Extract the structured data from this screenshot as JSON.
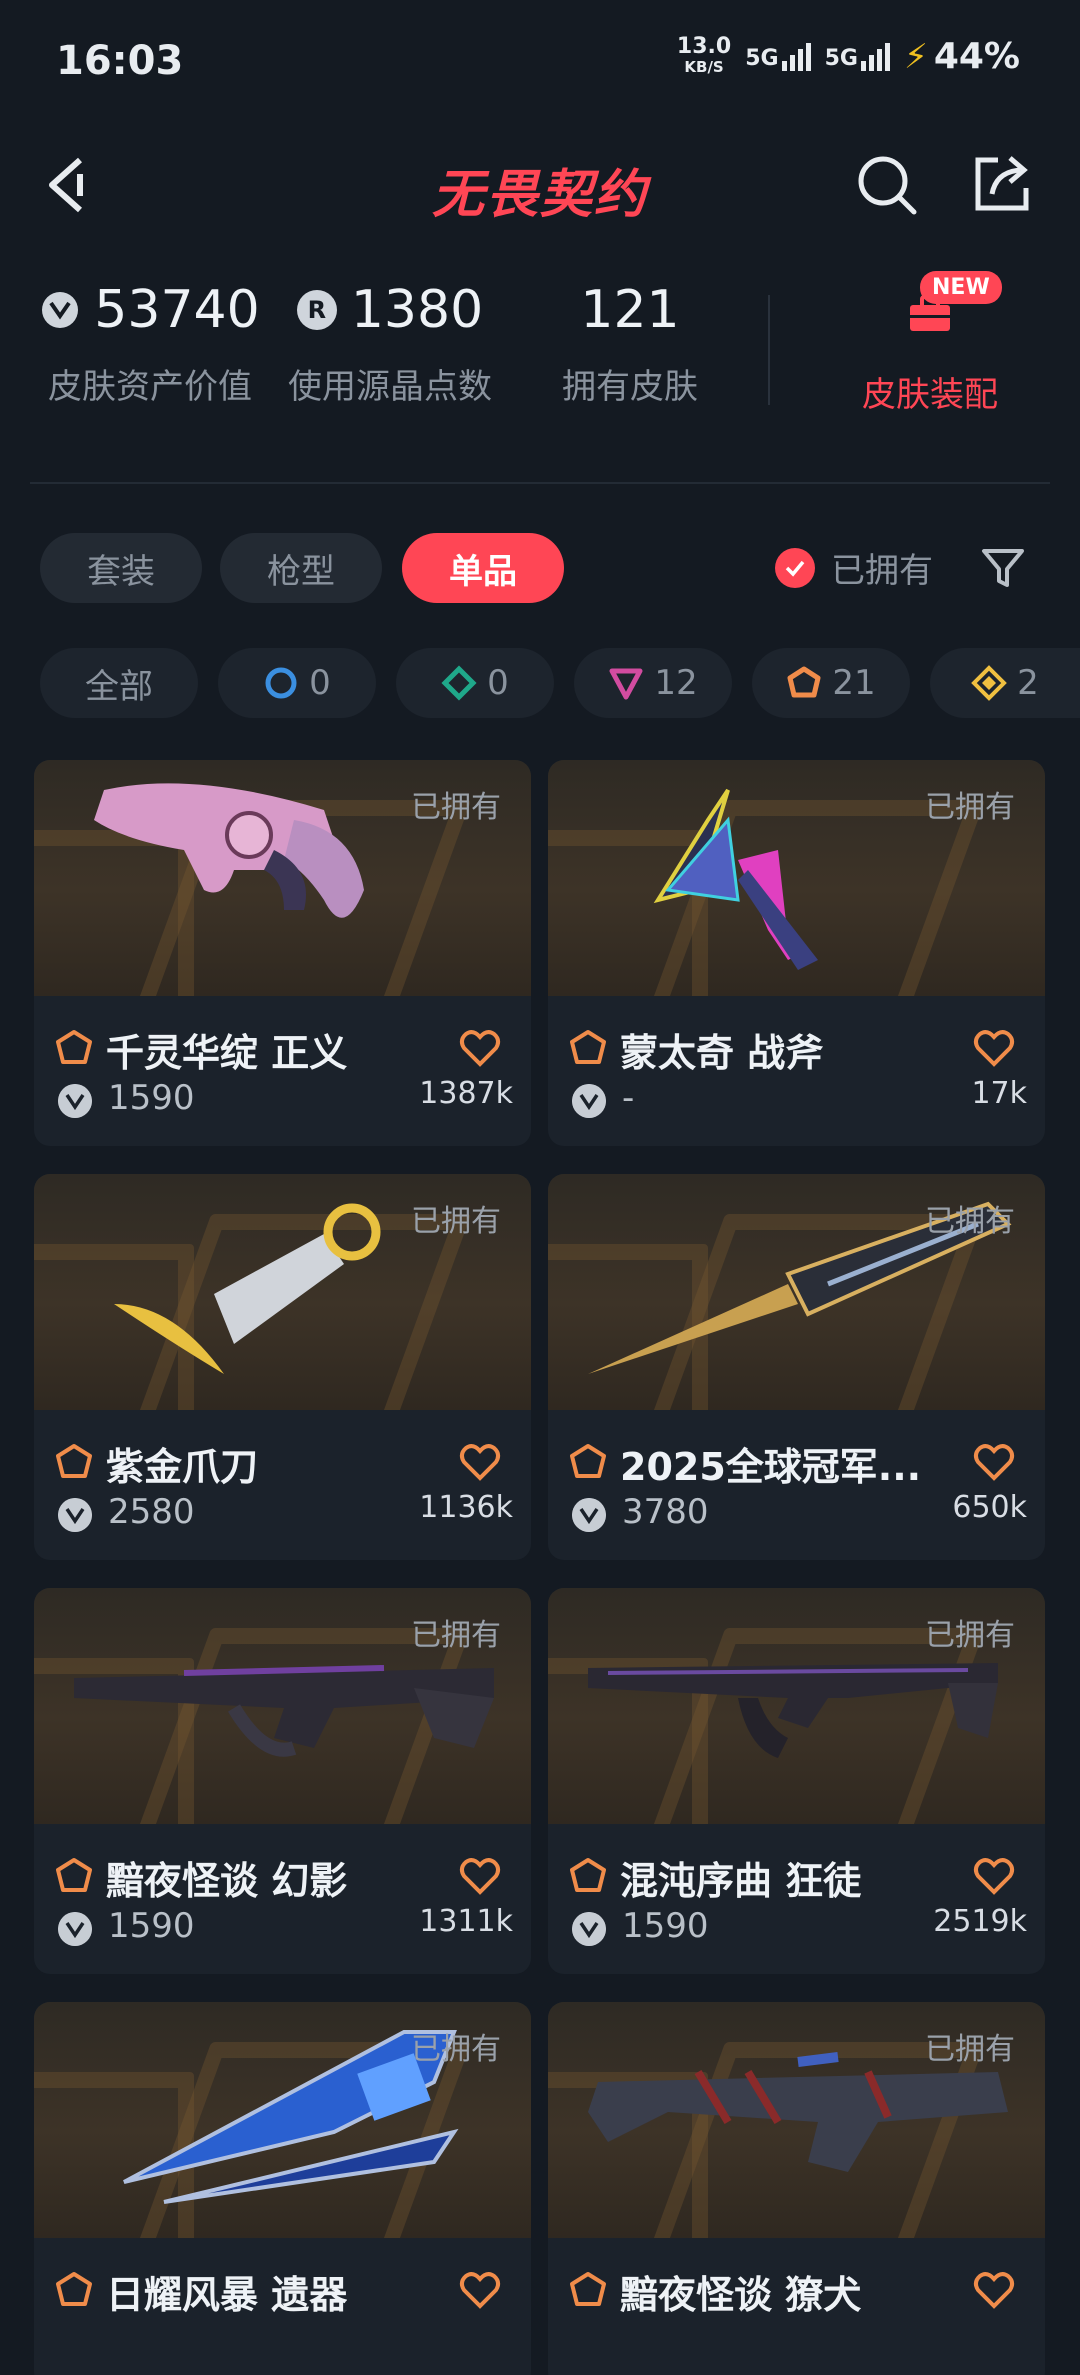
{
  "status": {
    "time": "16:03",
    "net_speed": "13.0",
    "net_unit": "KB/S",
    "sig1": "5G",
    "sig2": "5G",
    "battery": "44%"
  },
  "header": {
    "title": "无畏契约"
  },
  "stats": [
    {
      "value": "53740",
      "label": "皮肤资产价值",
      "icon": "vp-coin-icon"
    },
    {
      "value": "1380",
      "label": "使用源晶点数",
      "icon": "radianite-icon",
      "icon_text": "R"
    },
    {
      "value": "121",
      "label": "拥有皮肤"
    }
  ],
  "equip": {
    "label": "皮肤装配",
    "badge": "NEW"
  },
  "tabs": [
    "套装",
    "枪型",
    "单品"
  ],
  "active_tab": "单品",
  "owned_filter": "已拥有",
  "tiers": [
    {
      "label": "全部"
    },
    {
      "label": "0",
      "icon": "select-tier-icon",
      "color": "#3b8fe0"
    },
    {
      "label": "0",
      "icon": "deluxe-tier-icon",
      "color": "#1fa88a"
    },
    {
      "label": "12",
      "icon": "premium-tier-icon",
      "color": "#d24ca0"
    },
    {
      "label": "21",
      "icon": "exclusive-tier-icon",
      "color": "#f08c4a"
    },
    {
      "label": "2",
      "icon": "ultra-tier-icon",
      "color": "#f0c040"
    }
  ],
  "items": [
    {
      "name": "千灵华绽 正义",
      "price": "1590",
      "favs": "1387k",
      "owned": "已拥有",
      "weapon": "pistol"
    },
    {
      "name": "蒙太奇 战斧",
      "price": "-",
      "favs": "17k",
      "owned": "已拥有",
      "weapon": "axe"
    },
    {
      "name": "紫金爪刀",
      "price": "2580",
      "favs": "1136k",
      "owned": "已拥有",
      "weapon": "karambit"
    },
    {
      "name": "2025全球冠军...",
      "price": "3780",
      "favs": "650k",
      "owned": "已拥有",
      "weapon": "knife"
    },
    {
      "name": "黯夜怪谈 幻影",
      "price": "1590",
      "favs": "1311k",
      "owned": "已拥有",
      "weapon": "rifle"
    },
    {
      "name": "混沌序曲 狂徒",
      "price": "1590",
      "favs": "2519k",
      "owned": "已拥有",
      "weapon": "rifle2"
    },
    {
      "name": "日耀风暴 遗器",
      "price": "",
      "favs": "",
      "owned": "已拥有",
      "weapon": "blade"
    },
    {
      "name": "黯夜怪谈 獠犬",
      "price": "",
      "favs": "",
      "owned": "已拥有",
      "weapon": "smg"
    }
  ]
}
